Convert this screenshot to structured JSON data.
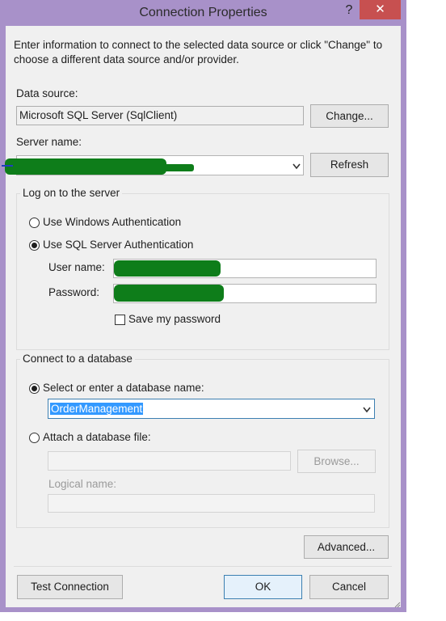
{
  "window": {
    "title": "Connection Properties",
    "help_glyph": "?",
    "close_glyph": "✕"
  },
  "intro": "Enter information to connect to the selected data source or click \"Change\" to choose a different data source and/or provider.",
  "data_source": {
    "label": "Data source:",
    "value": "Microsoft SQL Server (SqlClient)",
    "change_label": "Change..."
  },
  "server": {
    "label": "Server name:",
    "value": "",
    "refresh_label": "Refresh"
  },
  "logon": {
    "group_label": "Log on to the server",
    "windows_auth_label": "Use Windows Authentication",
    "windows_auth_selected": false,
    "sql_auth_label": "Use SQL Server Authentication",
    "sql_auth_selected": true,
    "username_label": "User name:",
    "username_value": "",
    "password_label": "Password:",
    "password_value": "",
    "save_password_label": "Save my password",
    "save_password_checked": false
  },
  "database": {
    "group_label": "Connect to a database",
    "select_label": "Select or enter a database name:",
    "select_selected": true,
    "name_value": "OrderManagement",
    "attach_label": "Attach a database file:",
    "attach_selected": false,
    "browse_label": "Browse...",
    "logical_name_label": "Logical name:"
  },
  "buttons": {
    "advanced": "Advanced...",
    "test_connection": "Test Connection",
    "ok": "OK",
    "cancel": "Cancel"
  },
  "colors": {
    "frame": "#a891c9",
    "close_button": "#c75050",
    "redaction": "#0e7d1a",
    "selection": "#3399ff"
  }
}
